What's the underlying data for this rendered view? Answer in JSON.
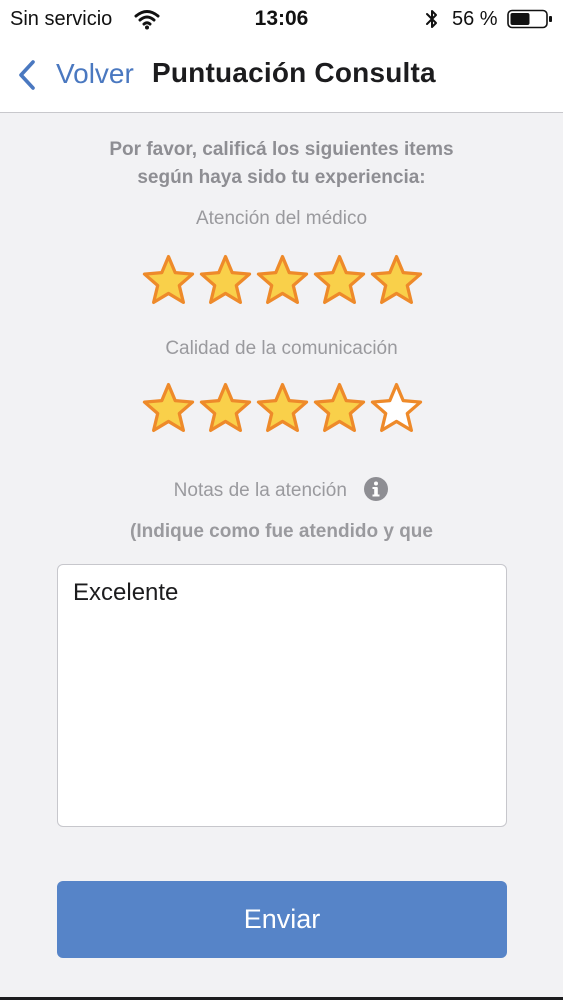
{
  "status_bar": {
    "carrier": "Sin servicio",
    "time": "13:06",
    "battery_percent": "56 %",
    "battery_level": 0.56
  },
  "nav": {
    "back_label": "Volver",
    "title": "Puntuación Consulta"
  },
  "form": {
    "instructions_line1": "Por favor, calificá los siguientes items",
    "instructions_line2": "según haya sido tu experiencia:",
    "ratings": [
      {
        "label": "Atención del médico",
        "value": 5,
        "max": 5
      },
      {
        "label": "Calidad de la comunicación",
        "value": 4,
        "max": 5
      }
    ],
    "notes_label": "Notas de la atención",
    "notes_hint": "(Indique como fue atendido y que",
    "notes_value": "Excelente",
    "submit_label": "Enviar"
  },
  "colors": {
    "accent": "#4a78c0",
    "button": "#5684c8",
    "star_fill": "#f9d04a",
    "star_stroke": "#ee8a2a",
    "muted_text": "#9a9a9e"
  },
  "icons": {
    "back": "chevron-left-icon",
    "info": "info-icon",
    "star": "star-icon"
  }
}
